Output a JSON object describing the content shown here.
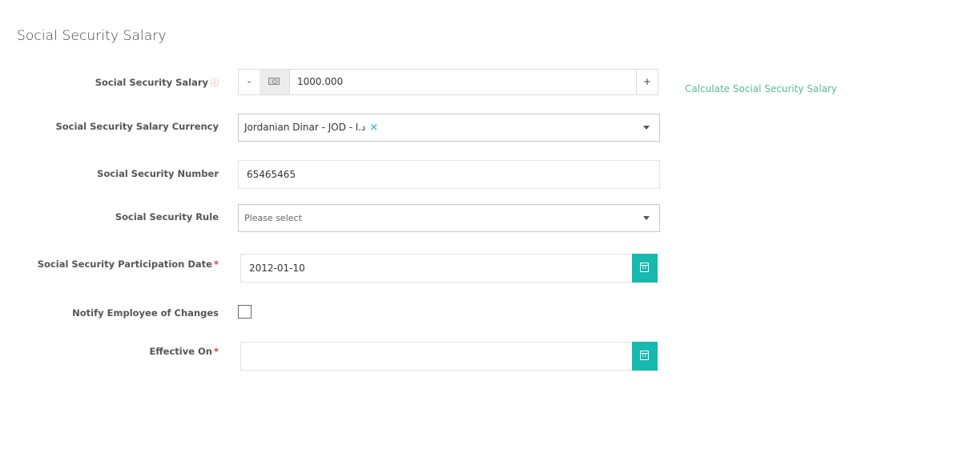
{
  "page": {
    "title": "Social Security Salary"
  },
  "salary": {
    "label": "Social Security Salary",
    "info_icon": "info-icon",
    "minus": "-",
    "plus": "+",
    "value": "1000.000",
    "money_icon": "money-icon",
    "calc_link": "Calculate Social Security Salary"
  },
  "currency": {
    "label": "Social Security Salary Currency",
    "value": "Jordanian Dinar - JOD - د.ا",
    "clear": "×"
  },
  "number": {
    "label": "Social Security Number",
    "value": "65465465"
  },
  "rule": {
    "label": "Social Security Rule",
    "placeholder": "Please select"
  },
  "participation": {
    "label": "Social Security Participation Date",
    "required": "*",
    "value": "2012-01-10",
    "calendar_icon": "calendar-icon"
  },
  "notify": {
    "label": "Notify Employee of Changes",
    "checked": false
  },
  "effective": {
    "label": "Effective On",
    "required": "*",
    "value": "",
    "calendar_icon": "calendar-icon"
  },
  "colors": {
    "accent": "#17b8ad",
    "link": "#5cb89c",
    "required": "#e53935"
  }
}
